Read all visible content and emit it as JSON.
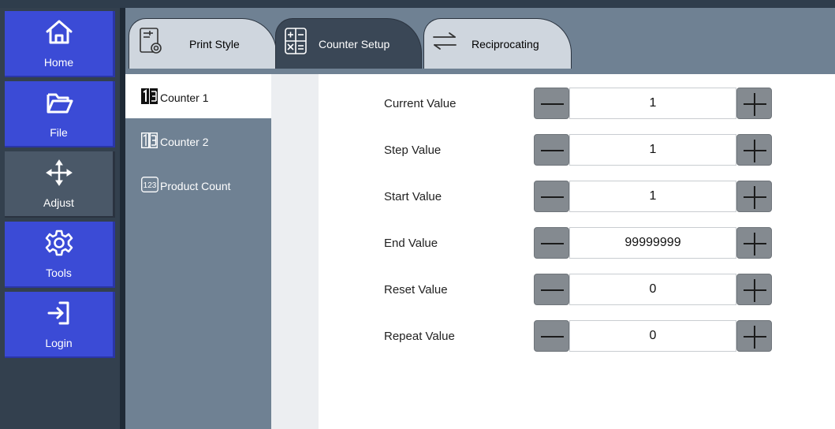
{
  "nav": {
    "items": [
      {
        "label": "Home",
        "icon": "home-icon"
      },
      {
        "label": "File",
        "icon": "folder-icon"
      },
      {
        "label": "Adjust",
        "icon": "move-arrows-icon",
        "active": true
      },
      {
        "label": "Tools",
        "icon": "gear-icon"
      },
      {
        "label": "Login",
        "icon": "login-icon"
      }
    ]
  },
  "tabs": [
    {
      "label": "Print Style",
      "icon": "print-style-icon"
    },
    {
      "label": "Counter Setup",
      "icon": "counter-setup-icon",
      "active": true
    },
    {
      "label": "Reciprocating",
      "icon": "reciprocating-arrows-icon"
    }
  ],
  "subnav": {
    "items": [
      {
        "label": "Counter 1",
        "icon": "counter-icon",
        "active": true
      },
      {
        "label": "Counter 2",
        "icon": "counter-icon"
      },
      {
        "label": "Product Count",
        "icon": "product-count-icon",
        "icon_text": "123"
      }
    ]
  },
  "fields": [
    {
      "label": "Current Value",
      "value": "1"
    },
    {
      "label": "Step Value",
      "value": "1"
    },
    {
      "label": "Start Value",
      "value": "1"
    },
    {
      "label": "End Value",
      "value": "99999999"
    },
    {
      "label": "Reset Value",
      "value": "0"
    },
    {
      "label": "Repeat Value",
      "value": "0"
    }
  ],
  "colors": {
    "nav_button": "#3b4bd6",
    "nav_active": "#4a5868",
    "panel": "#6f8193",
    "dark": "#33404e",
    "stepper_button": "#848a90"
  }
}
